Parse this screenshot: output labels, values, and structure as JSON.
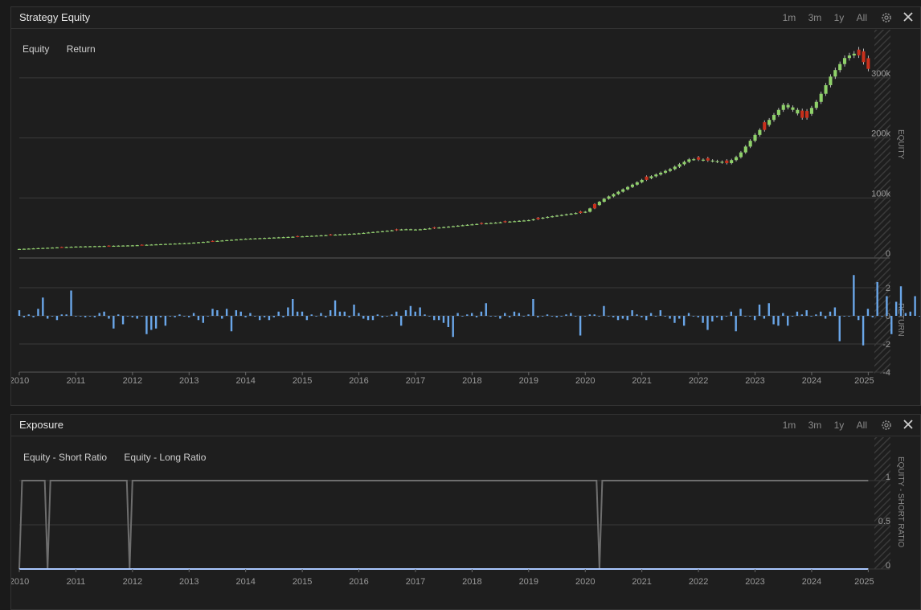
{
  "panels": {
    "equity": {
      "title": "Strategy Equity",
      "range_buttons": [
        "1m",
        "3m",
        "1y",
        "All"
      ],
      "legend": [
        "Equity",
        "Return"
      ],
      "equity_axis_label": "EQUITY",
      "return_axis_label": "RETURN"
    },
    "exposure": {
      "title": "Exposure",
      "range_buttons": [
        "1m",
        "3m",
        "1y",
        "All"
      ],
      "legend": [
        "Equity - Short Ratio",
        "Equity - Long Ratio"
      ],
      "axis_label": "EQUITY - SHORT RATIO"
    }
  },
  "colors": {
    "up": "#8fd16a",
    "down": "#c8301c",
    "returns": "#6aa6e8",
    "ratio_line": "#6e6e6e",
    "long_line": "#aac8ff"
  },
  "icons": [
    "gear-icon",
    "close-icon"
  ],
  "chart_data": [
    {
      "type": "candlestick",
      "title": "",
      "ylabel": "EQUITY",
      "ylim": [
        0,
        340000
      ],
      "yticks": [
        0,
        100000,
        200000,
        300000
      ],
      "ytick_labels": [
        "0",
        "100k",
        "200k",
        "300k"
      ],
      "xticks": [
        "2010",
        "2011",
        "2012",
        "2013",
        "2014",
        "2015",
        "2016",
        "2017",
        "2018",
        "2019",
        "2020",
        "2021",
        "2022",
        "2023",
        "2024",
        "2025"
      ],
      "xlim": [
        2010,
        2025.08
      ],
      "anchors": [
        [
          2010.0,
          15000
        ],
        [
          2011.0,
          19000
        ],
        [
          2012.0,
          21000
        ],
        [
          2013.0,
          25000
        ],
        [
          2014.0,
          32000
        ],
        [
          2015.0,
          36000
        ],
        [
          2016.0,
          41000
        ],
        [
          2016.8,
          48000
        ],
        [
          2017.0,
          47000
        ],
        [
          2018.0,
          56000
        ],
        [
          2019.0,
          63000
        ],
        [
          2019.3,
          68000
        ],
        [
          2020.0,
          77000
        ],
        [
          2020.3,
          97000
        ],
        [
          2021.0,
          130000
        ],
        [
          2021.5,
          148000
        ],
        [
          2021.85,
          165000
        ],
        [
          2022.2,
          162000
        ],
        [
          2022.5,
          158000
        ],
        [
          2022.7,
          170000
        ],
        [
          2023.0,
          205000
        ],
        [
          2023.5,
          255000
        ],
        [
          2023.7,
          245000
        ],
        [
          2023.85,
          232000
        ],
        [
          2024.1,
          262000
        ],
        [
          2024.35,
          305000
        ],
        [
          2024.6,
          335000
        ],
        [
          2024.8,
          342000
        ],
        [
          2025.0,
          315000
        ]
      ],
      "down_months": [
        2010.75,
        2011.6,
        2012.2,
        2013.4,
        2014.9,
        2015.5,
        2016.7,
        2017.3,
        2018.2,
        2018.6,
        2019.2,
        2019.9,
        2020.2,
        2021.1,
        2022.0,
        2022.2,
        2022.5,
        2023.2,
        2023.8,
        2023.9,
        2024.8,
        2024.9,
        2025.0
      ]
    },
    {
      "type": "bar",
      "title": "",
      "ylabel": "RETURN",
      "ylim": [
        -4,
        2.8
      ],
      "yticks": [
        -4,
        -2,
        0,
        2
      ],
      "ytick_labels": [
        "-4",
        "-2",
        "0",
        "2"
      ],
      "x_start": 2010.0,
      "x_step": 0.0833,
      "values": [
        0.4,
        -0.1,
        0.1,
        -0.1,
        0.5,
        1.3,
        -0.2,
        0.0,
        -0.3,
        0.1,
        0.1,
        1.8,
        0.0,
        0.0,
        -0.1,
        0.0,
        -0.1,
        0.2,
        0.3,
        -0.2,
        -0.9,
        0.1,
        -0.6,
        0.0,
        -0.1,
        -0.2,
        0.0,
        -1.3,
        -1.0,
        -0.9,
        -0.1,
        -0.7,
        0.0,
        -0.1,
        0.1,
        0.0,
        -0.1,
        0.2,
        -0.3,
        -0.5,
        0.0,
        0.5,
        0.4,
        -0.2,
        0.5,
        -1.1,
        0.4,
        0.3,
        -0.1,
        0.2,
        0.0,
        -0.3,
        -0.1,
        -0.3,
        -0.1,
        0.3,
        -0.1,
        0.6,
        1.2,
        0.3,
        0.3,
        -0.3,
        0.1,
        0.0,
        0.2,
        -0.1,
        0.4,
        1.1,
        0.3,
        0.3,
        -0.1,
        0.8,
        0.2,
        -0.2,
        -0.3,
        -0.3,
        0.1,
        -0.1,
        0.0,
        0.1,
        0.3,
        -0.7,
        0.4,
        0.7,
        0.3,
        0.6,
        0.1,
        0.0,
        -0.3,
        -0.3,
        -0.5,
        -0.8,
        -1.5,
        0.2,
        0.0,
        0.1,
        0.2,
        -0.1,
        0.3,
        0.9,
        0.0,
        0.0,
        -0.2,
        0.2,
        -0.1,
        0.3,
        0.2,
        0.0,
        0.1,
        1.2,
        -0.1,
        0.0,
        0.1,
        0.0,
        -0.1,
        0.0,
        0.1,
        0.2,
        0.0,
        -1.4,
        0.0,
        0.1,
        0.1,
        0.0,
        0.7,
        0.0,
        -0.1,
        -0.3,
        -0.2,
        -0.3,
        0.4,
        0.1,
        -0.1,
        -0.3,
        0.2,
        0.0,
        0.4,
        0.0,
        -0.2,
        -0.5,
        -0.2,
        -0.7,
        0.2,
        0.0,
        -0.1,
        -0.5,
        -1.0,
        -0.4,
        -0.1,
        -0.3,
        0.0,
        0.3,
        -1.1,
        0.5,
        0.0,
        0.0,
        -0.3,
        0.8,
        -0.2,
        0.9,
        -0.6,
        -0.7,
        0.2,
        -0.7,
        0.0,
        0.3,
        0.1,
        0.4,
        0.0,
        0.1,
        0.3,
        -0.2,
        0.3,
        0.6,
        -1.8,
        0.0,
        0.0,
        2.9,
        -0.3,
        -2.1,
        0.5,
        -0.1,
        2.4,
        0.0,
        1.4,
        -1.3,
        1.0,
        2.1,
        0.2,
        0.3,
        1.4,
        0.0,
        -0.4,
        0.0,
        0.0,
        1.0,
        0.2,
        -0.2,
        1.2,
        0.5,
        0.2,
        0.0,
        -0.2,
        -0.2,
        0.1,
        -0.3,
        -0.4,
        -0.3,
        0.0,
        0.5,
        0.0,
        -0.1,
        -0.4,
        -0.4,
        0.0,
        0.2,
        -0.4,
        0.1,
        1.2,
        -0.3,
        0.0,
        0.0,
        0.9,
        0.0,
        0.6,
        0.8,
        0.0,
        0.0,
        -1.9,
        0.1,
        -0.2,
        -1.5,
        -1.3,
        -0.5,
        0.1,
        0.0,
        0.0,
        0.2,
        0.1,
        0.1,
        -0.2,
        -0.6,
        0.0,
        0.9,
        0.2,
        0.2,
        0.1,
        -0.4,
        -0.3,
        -0.1,
        -0.2,
        0.3,
        0.0,
        0.0,
        -0.2,
        0.1,
        0.2,
        1.0,
        0.9,
        -0.5,
        -0.3,
        -0.1,
        0.3,
        1.0,
        0.0,
        -0.4,
        -0.3,
        -0.1,
        -0.2,
        0.2,
        -0.9,
        0.0,
        -0.2
      ],
      "xticks": [
        "2010",
        "2011",
        "2012",
        "2013",
        "2014",
        "2015",
        "2016",
        "2017",
        "2018",
        "2019",
        "2020",
        "2021",
        "2022",
        "2023",
        "2024",
        "2025"
      ]
    },
    {
      "type": "line",
      "title": "",
      "ylabel": "EQUITY - SHORT RATIO",
      "ylim": [
        0,
        1
      ],
      "yticks": [
        0,
        0.5,
        1
      ],
      "ytick_labels": [
        "0",
        "0.5",
        "1"
      ],
      "series": [
        {
          "name": "Equity - Short Ratio",
          "points": [
            [
              2010.0,
              0
            ],
            [
              2010.05,
              1
            ],
            [
              2010.45,
              1
            ],
            [
              2010.5,
              0
            ],
            [
              2010.55,
              1
            ],
            [
              2011.9,
              1
            ],
            [
              2011.95,
              0
            ],
            [
              2012.0,
              1
            ],
            [
              2020.2,
              1
            ],
            [
              2020.25,
              0
            ],
            [
              2020.3,
              1
            ],
            [
              2025.0,
              1
            ]
          ]
        },
        {
          "name": "Equity - Long Ratio",
          "points": [
            [
              2010.0,
              0
            ],
            [
              2025.0,
              0
            ]
          ]
        }
      ],
      "xticks": [
        "2010",
        "2011",
        "2012",
        "2013",
        "2014",
        "2015",
        "2016",
        "2017",
        "2018",
        "2019",
        "2020",
        "2021",
        "2022",
        "2023",
        "2024",
        "2025"
      ]
    }
  ]
}
